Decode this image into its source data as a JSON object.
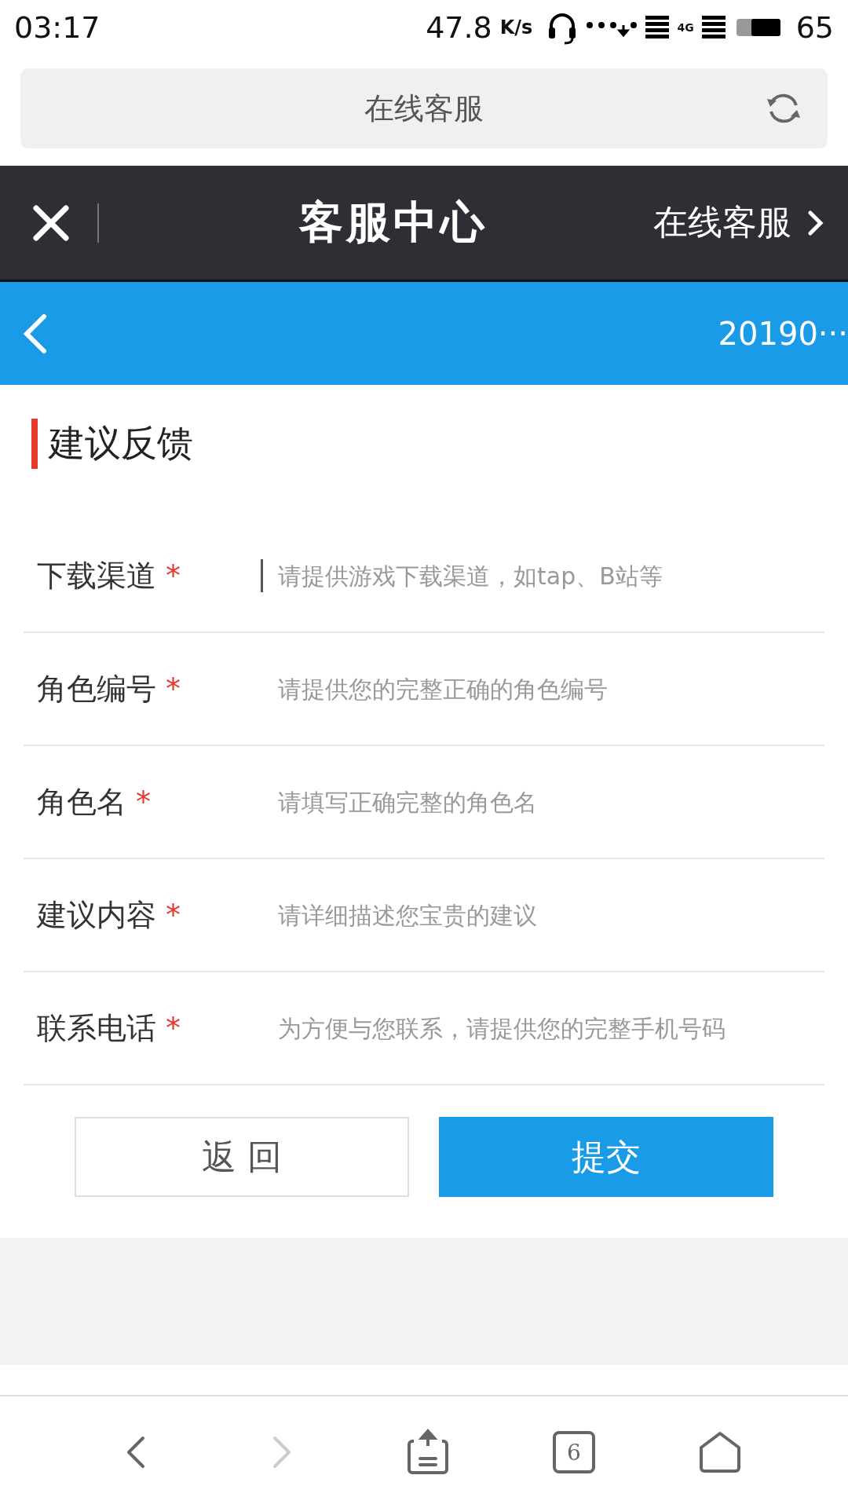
{
  "status_bar": {
    "time": "03:17",
    "speed": "47.8",
    "speed_unit": "K/s",
    "network": "4G",
    "battery": "65"
  },
  "address_bar": {
    "title": "在线客服"
  },
  "header": {
    "title": "客服中心",
    "link": "在线客服"
  },
  "sub_bar": {
    "text": "20190···"
  },
  "section": {
    "title": "建议反馈"
  },
  "fields": [
    {
      "label": "下载渠道",
      "mark": "*",
      "placeholder": "请提供游戏下载渠道，如tap、B站等",
      "focused": true
    },
    {
      "label": "角色编号",
      "mark": "*",
      "placeholder": "请提供您的完整正确的角色编号",
      "focused": false
    },
    {
      "label": "角色名",
      "mark": "*",
      "placeholder": "请填写正确完整的角色名",
      "focused": false
    },
    {
      "label": "建议内容",
      "mark": "*",
      "placeholder": "请详细描述您宝贵的建议",
      "focused": false
    },
    {
      "label": "联系电话",
      "mark": "*",
      "placeholder": "为方便与您联系，请提供您的完整手机号码",
      "focused": false
    }
  ],
  "buttons": [
    {
      "label": "返 回",
      "kind": "secondary"
    },
    {
      "label": "提交",
      "kind": "primary"
    }
  ],
  "bottom_nav": [
    {
      "kind": "back",
      "disabled": false
    },
    {
      "kind": "forward",
      "disabled": true
    },
    {
      "kind": "share",
      "disabled": false
    },
    {
      "kind": "tabs",
      "count": "6",
      "disabled": false
    },
    {
      "kind": "home",
      "disabled": false
    }
  ]
}
